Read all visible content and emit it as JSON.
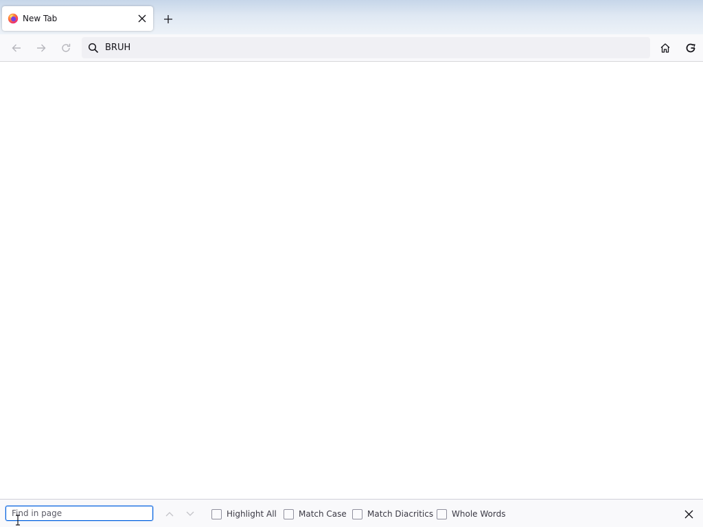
{
  "colors": {
    "accent": "#0060df",
    "toolbar_bg": "#f9f9fb",
    "urlbar_bg": "#f0f0f4",
    "tabstrip_top": "#c6d6e9"
  },
  "tabs": [
    {
      "title": "New Tab",
      "icon": "firefox-logo-icon",
      "active": true
    }
  ],
  "navbar": {
    "back_icon": "back-arrow-icon",
    "forward_icon": "forward-arrow-icon",
    "reload_icon": "reload-icon",
    "url_value": "BRUH",
    "search_icon": "search-icon",
    "home_icon": "home-icon",
    "account_icon": "sync-account-icon"
  },
  "findbar": {
    "placeholder": "Find in page",
    "value": "",
    "options": [
      {
        "label": "Highlight All",
        "checked": false
      },
      {
        "label": "Match Case",
        "checked": false
      },
      {
        "label": "Match Diacritics",
        "checked": false
      },
      {
        "label": "Whole Words",
        "checked": false
      }
    ]
  }
}
